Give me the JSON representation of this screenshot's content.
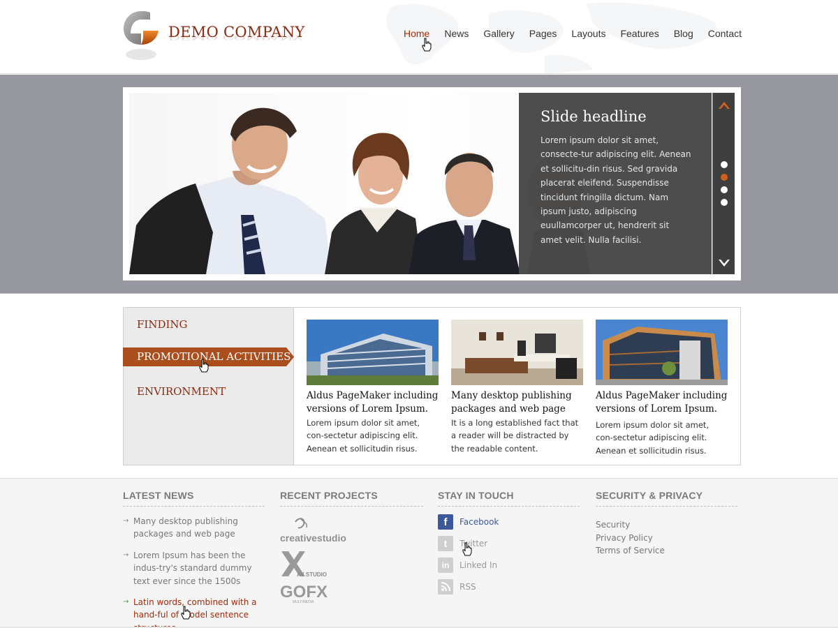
{
  "brand": {
    "name": "DEMO COMPANY"
  },
  "nav": {
    "items": [
      "Home",
      "News",
      "Gallery",
      "Pages",
      "Layouts",
      "Features",
      "Blog",
      "Contact"
    ],
    "active": "Home"
  },
  "slider": {
    "headline": "Slide headline",
    "text": "Lorem ipsum dolor sit amet, consecte-tur adipiscing elit. Aenean et sollicitu-din risus. Sed gravida placerat eleifend. Suspendisse tincidunt fringilla dictum. Nam ipsum justo, adipiscing euullamcorper ut, hendrerit sit amet velit. Nulla facilisi.",
    "slide_count": 4,
    "active_slide": 2
  },
  "sidebar": {
    "items": [
      "FINDING",
      "PROMOTIONAL ACTIVITIES",
      "ENVIRONMENT"
    ],
    "active": "PROMOTIONAL ACTIVITIES"
  },
  "cards": [
    {
      "title": "Aldus PageMaker including versions of Lorem Ipsum.",
      "text": "Lorem ipsum dolor sit amet, con-sectetur adipiscing elit. Aenean et sollicitudin risus."
    },
    {
      "title": "Many desktop publishing packages and web page",
      "text": "It is a long established fact that a reader will be distracted by the readable content."
    },
    {
      "title": "Aldus PageMaker including versions of Lorem Ipsum.",
      "text": "Lorem ipsum dolor sit amet, con-sectetur adipiscing elit. Aenean et sollicitudin risus."
    }
  ],
  "footer": {
    "latest_news": {
      "title": "LATEST NEWS",
      "items": [
        "Many desktop publishing packages and web page",
        "Lorem Ipsum has been the indus-try's standard dummy text ever since the 1500s",
        "Latin words, combined with a hand-ful of model sentence structures"
      ]
    },
    "recent_projects": {
      "title": "RECENT PROJECTS",
      "logos": [
        "creativestudio",
        "AV STUDIO",
        "GOFX",
        "MULTIMEDIA"
      ]
    },
    "stay_in_touch": {
      "title": "STAY IN TOUCH",
      "links": [
        "Facebook",
        "Twitter",
        "Linked In",
        "RSS"
      ]
    },
    "security": {
      "title": "SECURITY & PRIVACY",
      "links": [
        "Security",
        "Privacy Policy",
        "Terms of Service"
      ]
    }
  },
  "colors": {
    "accent": "#a52a00",
    "brand": "#8b2a12",
    "slider_band": "#97979f",
    "active_tab": "#a94e1c",
    "facebook": "#3b5998"
  }
}
